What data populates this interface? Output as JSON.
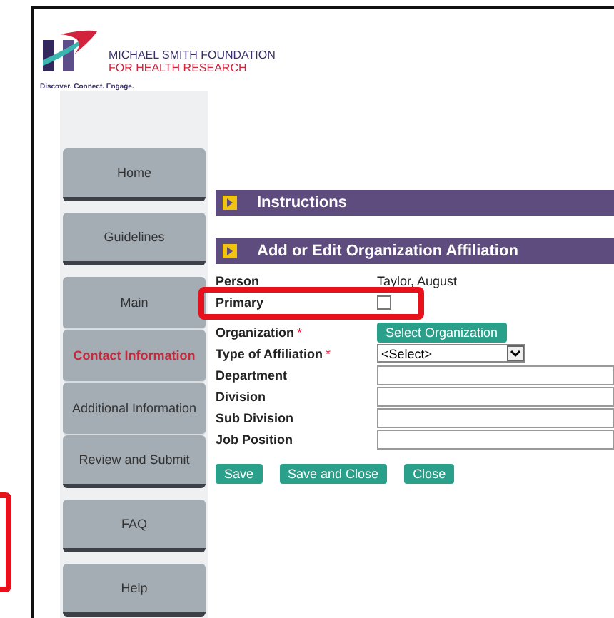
{
  "logo": {
    "line_1": "MICHAEL SMITH FOUNDATION",
    "line_2": "FOR HEALTH RESEARCH",
    "tagline": "Discover. Connect. Engage."
  },
  "sidebar": {
    "items": [
      {
        "label": "Home",
        "kind": "single",
        "selected": false
      },
      {
        "label": "Guidelines",
        "kind": "single",
        "selected": false
      },
      {
        "label": "Main",
        "kind": "grouped",
        "selected": false
      },
      {
        "label": "Contact Information",
        "kind": "grouped",
        "selected": true
      },
      {
        "label": "Additional Information",
        "kind": "grouped",
        "selected": false
      },
      {
        "label": "Review and Submit",
        "kind": "grouped",
        "selected": false
      },
      {
        "label": "FAQ",
        "kind": "single",
        "selected": false
      },
      {
        "label": "Help",
        "kind": "single",
        "selected": false
      }
    ]
  },
  "sections": [
    {
      "title": "Instructions"
    },
    {
      "title": "Add or Edit Organization Affiliation"
    }
  ],
  "fields": [
    {
      "label": "Person",
      "kind": "text",
      "value": "Taylor, August"
    },
    {
      "label": "Primary",
      "kind": "checkbox",
      "checked": false
    },
    {
      "label": "Organization",
      "kind": "button",
      "value": "Select Organization",
      "required_mark": "*"
    },
    {
      "label": "Type of Affiliation",
      "kind": "select",
      "value": "<Select>",
      "required_mark": "*"
    },
    {
      "label": "Department",
      "kind": "input"
    },
    {
      "label": "Division",
      "kind": "input"
    },
    {
      "label": "Sub Division",
      "kind": "input"
    },
    {
      "label": "Job Position",
      "kind": "input"
    }
  ],
  "buttons": [
    "Save",
    "Save and Close",
    "Close"
  ]
}
